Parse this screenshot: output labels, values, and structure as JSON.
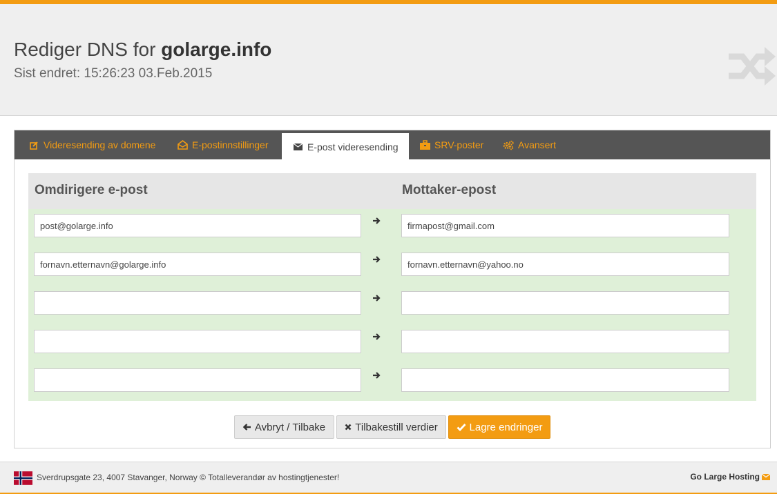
{
  "header": {
    "title_prefix": "Rediger DNS for",
    "domain": "golarge.info",
    "last_changed": "Sist endret: 15:26:23 03.Feb.2015",
    "icon": "shuffle-icon"
  },
  "tabs": [
    {
      "label": "Videresending av domene",
      "icon": "edit-icon",
      "active": false
    },
    {
      "label": "E-postinnstillinger",
      "icon": "envelope-open-icon",
      "active": false
    },
    {
      "label": "E-post videresending",
      "icon": "envelope-icon",
      "active": true
    },
    {
      "label": "SRV-poster",
      "icon": "briefcase-icon",
      "active": false
    },
    {
      "label": "Avansert",
      "icon": "cogs-icon",
      "active": false
    }
  ],
  "forward_table": {
    "col_source": "Omdirigere e-post",
    "col_target": "Mottaker-epost",
    "rows": [
      {
        "source": "post@golarge.info",
        "target": "firmapost@gmail.com"
      },
      {
        "source": "fornavn.etternavn@golarge.info",
        "target": "fornavn.etternavn@yahoo.no"
      },
      {
        "source": "",
        "target": ""
      },
      {
        "source": "",
        "target": ""
      },
      {
        "source": "",
        "target": ""
      }
    ]
  },
  "buttons": {
    "cancel": "Avbryt / Tilbake",
    "reset": "Tilbakestill verdier",
    "save": "Lagre endringer"
  },
  "footer": {
    "address": "Sverdrupsgate 23, 4007 Stavanger, Norway © Totalleverandør av hostingtjenester!",
    "brand": "Go Large Hosting"
  },
  "colors": {
    "accent": "#f39c12",
    "tabbar": "#555555",
    "row_bg": "#dff0d8",
    "header_bg": "#efefef"
  }
}
